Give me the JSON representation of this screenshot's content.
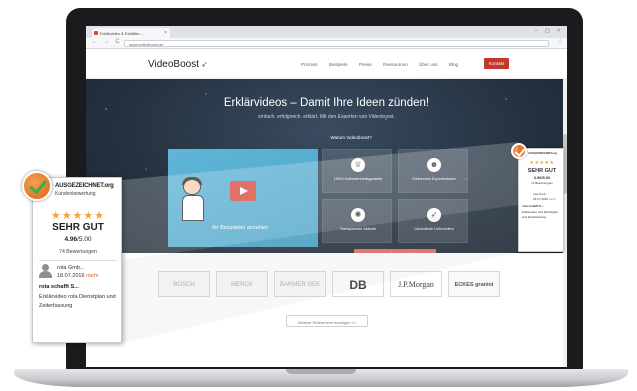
{
  "browser": {
    "tab_title": "Erklärvideo & Erkläflm-...",
    "tab_close": "×",
    "window_buttons": "– ▢ ×",
    "nav": "← → C",
    "url": "www.videoboost.de"
  },
  "site": {
    "logo": "VideoBoost",
    "nav_items": [
      "Prozess",
      "Beispiele",
      "Preise",
      "Ressourcen",
      "Über uns",
      "Blog"
    ],
    "contact_button": "Kontakt",
    "hero_title": "Erklärvideos – Damit Ihre Ideen zünden!",
    "hero_subtitle": "einfach. erfolgreich. erklärt. Mit den Experten von Videoboost.",
    "why_label": "Warum Videoboost?",
    "video_caption": "Ihr Beispielen ansehen",
    "features": [
      "100% Zufriedenheitsgarantie",
      "Erfahrenes Expertenteam",
      "Transparente Abläufe",
      "Garantierte Lieferzeiten"
    ],
    "cta_button": "Jetzt Anfrage stellen",
    "references": [
      "BOSCH",
      "MERCK",
      "BARMER GEK",
      "DB",
      "J.P.Morgan",
      "ECKES granini"
    ],
    "more_refs_button": "Weitere Referenzen anzeigen >>"
  },
  "mini_badge": {
    "title": "AUSGEZEICHNET.org",
    "stars": "★★★★★",
    "grade": "SEHR GUT",
    "score": "4.96/5.00",
    "count": "74 Bewertungen",
    "reviewer": "rota Gmb...",
    "date": "18.07.2016",
    "more": "mehr",
    "head": "rota schafft S...",
    "body": "Erklärvideo rota Dienstplan und Zeiterfassung"
  },
  "badge": {
    "title": "AUSGEZEICHNET.org",
    "subtitle": "Kundenbewertung",
    "stars": "★★★★★",
    "grade": "SEHR GUT",
    "score_value": "4.96",
    "score_max": "/5.00",
    "count": "74 Bewertungen",
    "reviewer": "rota Gmb...",
    "date": "18.07.2016",
    "more": "mehr",
    "review_head": "rota schafft S...",
    "review_body": "Erklärvideo rota Dienstplan und Zeiterfassung"
  },
  "colors": {
    "accent_red": "#c0392b",
    "cta": "#e06b65",
    "seal_orange": "#e9762b",
    "star": "#f2a33a"
  }
}
